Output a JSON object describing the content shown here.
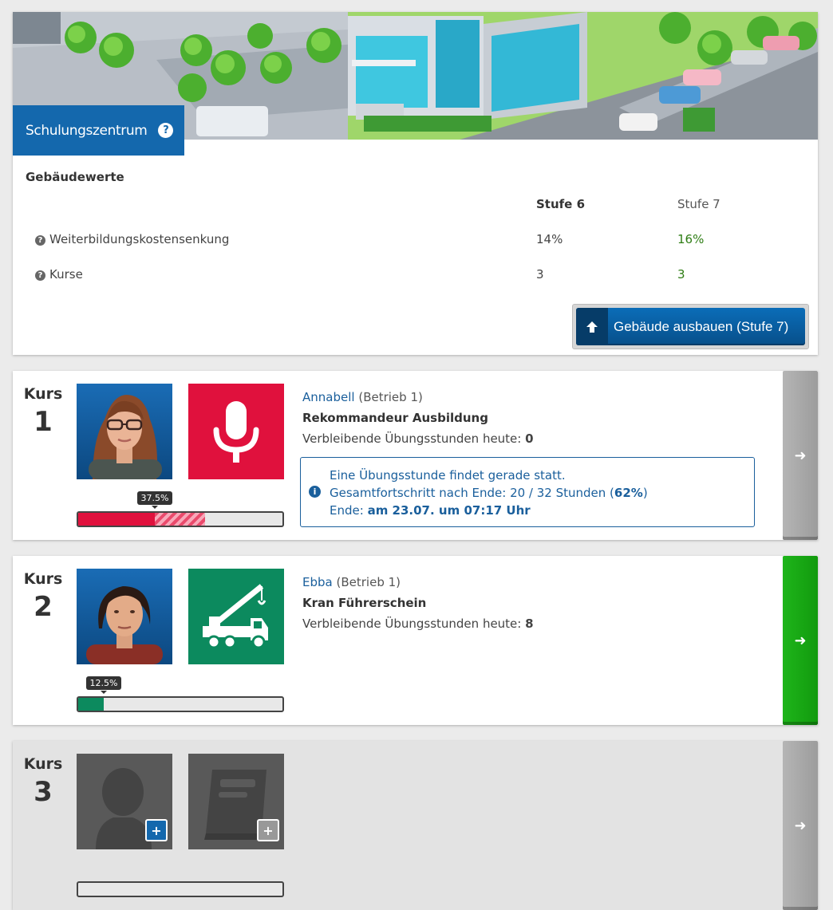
{
  "building": {
    "title": "Schulungszentrum",
    "help_icon": "question-circle-icon",
    "values_heading": "Gebäudewerte",
    "columns": [
      "Stufe 6",
      "Stufe 7"
    ],
    "rows": [
      {
        "label": "Weiterbildungskostensenkung",
        "current": "14%",
        "next": "16%"
      },
      {
        "label": "Kurse",
        "current": "3",
        "next": "3"
      }
    ],
    "upgrade_label": "Gebäude ausbauen (Stufe 7)",
    "colors": {
      "primary": "#1468ad",
      "green_value": "#2e7d14"
    }
  },
  "courses": [
    {
      "heading": "Kurs",
      "number": "1",
      "employee": "Annabell",
      "plant": "(Betrieb 1)",
      "course_name": "Rekommandeur Ausbildung",
      "remaining_label": "Verbleibende Übungsstunden heute:",
      "remaining_value": "0",
      "progress_pct": "37.5%",
      "progress_value": 0.375,
      "progress_projected": 0.62,
      "skill_icon": "microphone-icon",
      "skill_color": "#e0113d",
      "status": {
        "line1": "Eine Übungsstunde findet gerade statt.",
        "line2_prefix": "Gesamtfortschritt nach Ende: 20 / 32 Stunden (",
        "line2_pct": "62%",
        "line2_suffix": ")",
        "line3_prefix": "Ende:",
        "line3_value": "am 23.07. um 07:17 Uhr"
      }
    },
    {
      "heading": "Kurs",
      "number": "2",
      "employee": "Ebba",
      "plant": "(Betrieb 1)",
      "course_name": "Kran Führerschein",
      "remaining_label": "Verbleibende Übungsstunden heute:",
      "remaining_value": "8",
      "progress_pct": "12.5%",
      "progress_value": 0.125,
      "skill_icon": "crane-truck-icon",
      "skill_color": "#0c8a5e"
    },
    {
      "heading": "Kurs",
      "number": "3",
      "progress_value": 0,
      "skill_icon": "book-icon"
    }
  ]
}
